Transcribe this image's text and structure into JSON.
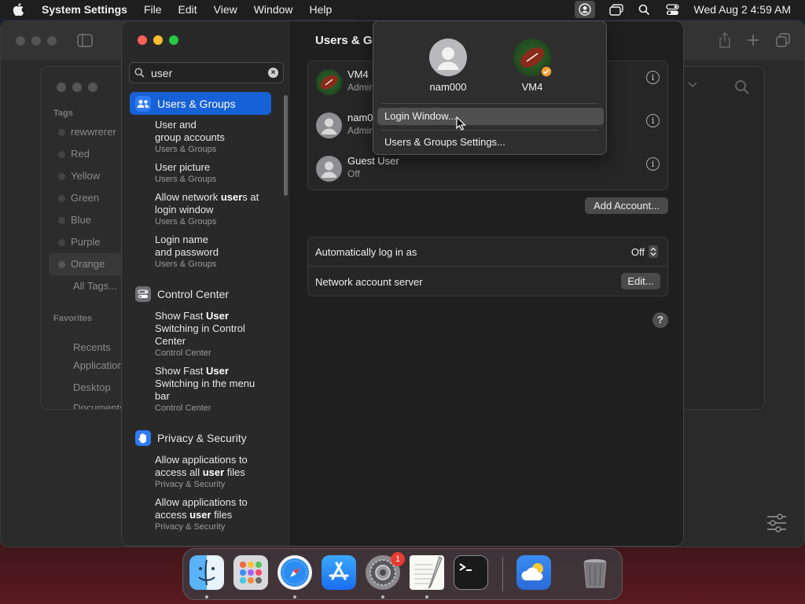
{
  "menubar": {
    "app_name": "System Settings",
    "items": [
      "File",
      "Edit",
      "View",
      "Window",
      "Help"
    ],
    "clock": "Wed Aug 2  4:59 AM"
  },
  "finder_sidebar": {
    "tags_header": "Tags",
    "tags": [
      "rewwrerer",
      "Red",
      "Yellow",
      "Green",
      "Blue",
      "Purple",
      "Orange",
      "All Tags..."
    ],
    "favorites_header": "Favorites",
    "favorites": [
      "Recents",
      "Applications",
      "Desktop",
      "Documents"
    ]
  },
  "search": {
    "value": "user"
  },
  "sidebar_sections": [
    {
      "label": "Users & Groups",
      "results": [
        {
          "line1_pre": "User",
          "line1_bold": "",
          "line1_post": " and",
          "line2": "group accounts",
          "line3": "",
          "sub": "Users & Groups"
        },
        {
          "line1_pre": "User",
          "line1_bold": "",
          "line1_post": " picture",
          "line2": "",
          "line3": "",
          "sub": "Users & Groups"
        },
        {
          "line1_pre": "Allow network ",
          "line1_bold": "user",
          "line1_post": "s at",
          "line2": "login window",
          "line3": "",
          "sub": "Users & Groups"
        },
        {
          "line1_pre": "Login name",
          "line1_bold": "",
          "line1_post": "",
          "line2": "and password",
          "line3": "",
          "sub": "Users & Groups"
        }
      ]
    },
    {
      "label": "Control Center",
      "results": [
        {
          "line1_pre": "Show Fast ",
          "line1_bold": "User",
          "line1_post": "",
          "line2": "Switching in Control",
          "line3": "Center",
          "sub": "Control Center"
        },
        {
          "line1_pre": "Show Fast ",
          "line1_bold": "User",
          "line1_post": "",
          "line2": "Switching in the menu",
          "line3": "bar",
          "sub": "Control Center"
        }
      ]
    },
    {
      "label": "Privacy & Security",
      "results": [
        {
          "line1_pre": "Allow applications to",
          "line1_bold": "",
          "line1_post": "",
          "line2_pre": "access all ",
          "line2_bold": "user",
          "line2_post": " files",
          "sub": "Privacy & Security"
        },
        {
          "line1_pre": "Allow applications to",
          "line1_bold": "",
          "line1_post": "",
          "line2_pre": "access ",
          "line2_bold": "user",
          "line2_post": " files",
          "sub": "Privacy & Security"
        }
      ]
    }
  ],
  "content": {
    "title": "Users & Gr",
    "users": [
      {
        "name": "VM4",
        "role": "Admin"
      },
      {
        "name": "nam0",
        "role": "Admin"
      },
      {
        "name": "Guest User",
        "role": "Off"
      }
    ],
    "add_account_label": "Add Account...",
    "auto_login_label": "Automatically log in as",
    "auto_login_value": "Off",
    "network_server_label": "Network account server",
    "edit_label": "Edit...",
    "help_label": "?"
  },
  "dropdown": {
    "users": [
      {
        "name": "nam000"
      },
      {
        "name": "VM4"
      }
    ],
    "items": [
      "Login Window...",
      "Users & Groups Settings..."
    ]
  },
  "dock": {
    "badge": "1",
    "apps": [
      "finder-icon",
      "launchpad-icon",
      "safari-icon",
      "app-store-icon",
      "system-settings-icon",
      "textedit-icon",
      "terminal-icon",
      "weather-icon",
      "trash-icon"
    ]
  },
  "colors": {
    "accent": "#1761d6",
    "close": "#fe5f57",
    "minimize": "#febc2e",
    "zoom": "#28c840"
  }
}
